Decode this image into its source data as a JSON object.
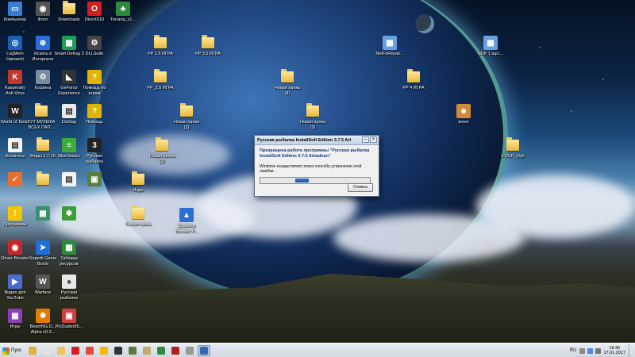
{
  "desktop": {
    "icons": [
      {
        "label": "Компьютер",
        "icon": "computer-icon",
        "kind": "sq",
        "color": "#3a7bd5",
        "glyph": "▭"
      },
      {
        "label": "Фото",
        "icon": "camera-icon",
        "kind": "sq",
        "color": "#555",
        "glyph": "◉"
      },
      {
        "label": "Downloads",
        "icon": "downloads-folder-icon",
        "kind": "folder"
      },
      {
        "label": "DirectX10",
        "icon": "directx-icon",
        "kind": "sq",
        "color": "#d21e1e",
        "glyph": "O"
      },
      {
        "label": "Terraria_v1...",
        "icon": "terraria-icon",
        "kind": "sq",
        "color": "#2b8a3e",
        "glyph": "♣"
      },
      {
        "label": "LogMeIn Hamachi",
        "icon": "hamachi-icon",
        "kind": "sq",
        "color": "#1a5fb4",
        "glyph": "◎"
      },
      {
        "label": "Искать в Интернете",
        "icon": "search-internet-icon",
        "kind": "sq",
        "color": "#2a6fd6",
        "glyph": "⊕"
      },
      {
        "label": "Smart Defrag 3",
        "icon": "defrag-icon",
        "kind": "sq",
        "color": "#1c9c55",
        "glyph": "▦"
      },
      {
        "label": "DLLSuite",
        "icon": "dllsuite-icon",
        "kind": "sq",
        "color": "#444",
        "glyph": "⚙"
      },
      {
        "label": "Kaspersky Anti-Virus",
        "icon": "kaspersky-icon",
        "kind": "sq",
        "color": "#c0392b",
        "glyph": "K"
      },
      {
        "label": "Корзина",
        "icon": "recycle-bin-icon",
        "kind": "sq",
        "color": "#7a8ba0",
        "glyph": "♲"
      },
      {
        "label": "GeForce Experience",
        "icon": "geforce-icon",
        "kind": "sq",
        "color": "#333",
        "glyph": "◣"
      },
      {
        "label": "Помощь по играм",
        "icon": "help-games-icon",
        "kind": "sq",
        "color": "#e2b400",
        "glyph": "?"
      },
      {
        "label": "World of Tanks",
        "icon": "wot-icon",
        "kind": "sq",
        "color": "#222",
        "glyph": "W"
      },
      {
        "label": "ТУТ МУЗЫКА ВСЕХ ПАП...",
        "icon": "music-folder-icon",
        "kind": "folder"
      },
      {
        "label": "DxDiag",
        "icon": "dxdiag-icon",
        "kind": "sq",
        "color": "#e9e9e9",
        "glyph": "▤"
      },
      {
        "label": "Помощь",
        "icon": "help-icon",
        "kind": "sq",
        "color": "#e2b400",
        "glyph": "?"
      },
      {
        "label": "Блокноты",
        "icon": "notepad-icon",
        "kind": "sq",
        "color": "#f4f4f4",
        "glyph": "▤"
      },
      {
        "label": "Моды 1.7.10",
        "icon": "mods-folder-icon",
        "kind": "folder"
      },
      {
        "label": "BlueStacks",
        "icon": "bluestacks-icon",
        "kind": "sq",
        "color": "#3caa3c",
        "glyph": "≡"
      },
      {
        "label": "Русская рыбалка",
        "icon": "russian-fishing-icon",
        "kind": "sq",
        "color": "#222",
        "glyph": "3"
      },
      {
        "label": "",
        "icon": "checkmark-icon",
        "kind": "sq",
        "color": "#e96e2e",
        "glyph": "✓"
      },
      {
        "label": "",
        "icon": "folder-icon",
        "kind": "folder"
      },
      {
        "label": "",
        "icon": "document-icon",
        "kind": "sq",
        "color": "#f4f4f4",
        "glyph": "▤"
      },
      {
        "label": "",
        "icon": "minecraft-icon",
        "kind": "sq",
        "color": "#5a7d3a",
        "glyph": "▣"
      },
      {
        "label": "Программы",
        "icon": "warning-icon",
        "kind": "sq",
        "color": "#f5c400",
        "glyph": "!"
      },
      {
        "label": "",
        "icon": "app-icon",
        "kind": "sq",
        "color": "#3b8f6a",
        "glyph": "▦"
      },
      {
        "label": "",
        "icon": "green-app-icon",
        "kind": "sq",
        "color": "#3c9c3c",
        "glyph": "✱"
      },
      {
        "label": "Driver Booster",
        "icon": "driver-booster-icon",
        "kind": "sq",
        "color": "#c62828",
        "glyph": "◉"
      },
      {
        "label": "Superb Game Boost",
        "icon": "game-boost-icon",
        "kind": "sq",
        "color": "#1e6fd9",
        "glyph": "➤"
      },
      {
        "label": "Таблица ресурсов",
        "icon": "spreadsheet-icon",
        "kind": "sq",
        "color": "#2e8b3d",
        "glyph": "▦"
      },
      {
        "label": "Видео для YouTube",
        "icon": "video-icon",
        "kind": "sq",
        "color": "#4a6bd1",
        "glyph": "▶"
      },
      {
        "label": "Warface",
        "icon": "warface-icon",
        "kind": "sq",
        "color": "#555",
        "glyph": "W"
      },
      {
        "label": "Русская рыбалка",
        "icon": "fishing-shortcut-icon",
        "kind": "sq",
        "color": "#e8e8e8",
        "glyph": "♠"
      },
      {
        "label": "Игры",
        "icon": "games-folder-icon",
        "kind": "sq",
        "color": "#8a3fb5",
        "glyph": "▦"
      },
      {
        "label": "BeamNG.D... Alpha v0.3...",
        "icon": "beamng-icon",
        "kind": "sq",
        "color": "#e07b00",
        "glyph": "✹"
      },
      {
        "label": "PicDuster05...",
        "icon": "picduster-icon",
        "kind": "sq",
        "color": "#d04040",
        "glyph": "▣"
      },
      {
        "label": "PP 1.5 ИГРА",
        "icon": "pp15-folder-icon",
        "kind": "folder"
      },
      {
        "label": "PP 3.5 ИГРА",
        "icon": "pp35-folder-icon",
        "kind": "folder"
      },
      {
        "label": "PP_2.0 ИГРА",
        "icon": "pp20-folder-icon",
        "kind": "folder"
      },
      {
        "label": "Новая папка (4)",
        "icon": "new-folder-4-icon",
        "kind": "folder"
      },
      {
        "label": "PP 4 ИГРА",
        "icon": "pp4-folder-icon",
        "kind": "folder"
      },
      {
        "label": "Новая папка (3)",
        "icon": "new-folder-3a-icon",
        "kind": "folder"
      },
      {
        "label": "Новая папка (3)",
        "icon": "new-folder-3b-icon",
        "kind": "folder"
      },
      {
        "label": "Новая папка (2)",
        "icon": "new-folder-2-icon",
        "kind": "folder"
      },
      {
        "label": "Игры",
        "icon": "games-folder-2-icon",
        "kind": "folder"
      },
      {
        "label": "Новая папка",
        "icon": "new-folder-icon",
        "kind": "folder"
      },
      {
        "label": "Драйвер Booster P...",
        "icon": "booster-shortcut-icon",
        "kind": "sq",
        "color": "#2c6fd1",
        "glyph": "▲"
      },
      {
        "label": "NetFxRepair...",
        "icon": "netfx-icon",
        "kind": "sq",
        "color": "#6aa0e0",
        "glyph": "▦"
      },
      {
        "label": "NDP 1 lap1...",
        "icon": "ndp-icon",
        "kind": "sq",
        "color": "#6aa0e0",
        "glyph": "▦"
      },
      {
        "label": "steve",
        "icon": "steve-icon",
        "kind": "sq",
        "color": "#d08a3a",
        "glyph": "☻"
      },
      {
        "label": "2-VCR_Hyb",
        "icon": "vcr-folder-icon",
        "kind": "folder"
      }
    ]
  },
  "dialog": {
    "title": "Русская рыбалка InstallSoft Edition 3.7.5 Arkadi...",
    "heading": "Прекращена работа программы \"Русская рыбалка InstallSoft Edition 3.7.5 Arkadium\"",
    "message": "Windows осуществляет поиск способа устранения этой ошибки...",
    "cancel_label": "Отмена",
    "minimize_glyph": "–",
    "close_glyph": "×",
    "progress_fraction": 0.12
  },
  "taskbar": {
    "start_label": "Пуск",
    "buttons": [
      {
        "name": "taskbar-explorer",
        "color": "#e0b23a"
      },
      {
        "name": "taskbar-media",
        "color": "#e2e2e2"
      },
      {
        "name": "taskbar-folder",
        "color": "#f0c85a"
      },
      {
        "name": "taskbar-opera",
        "color": "#d21e1e"
      },
      {
        "name": "taskbar-chrome",
        "color": "#e04b3c"
      },
      {
        "name": "taskbar-yandex",
        "color": "#f6b800"
      },
      {
        "name": "taskbar-wot",
        "color": "#333333"
      },
      {
        "name": "taskbar-minecraft",
        "color": "#5a7d3a"
      },
      {
        "name": "taskbar-video",
        "color": "#c8a86a"
      },
      {
        "name": "taskbar-terraria",
        "color": "#2b8a3e"
      },
      {
        "name": "taskbar-roblox",
        "color": "#b01e1e"
      },
      {
        "name": "taskbar-app",
        "color": "#999999"
      },
      {
        "name": "taskbar-fishing",
        "color": "#3a66b0"
      }
    ],
    "language": "RU",
    "time": "18:46",
    "date": "17.01.2017"
  }
}
